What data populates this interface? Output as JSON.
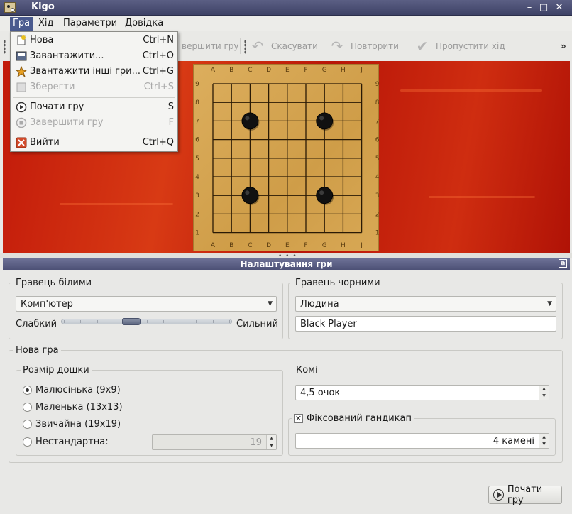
{
  "window": {
    "title": "Kigo"
  },
  "menubar": [
    {
      "label": "Гра"
    },
    {
      "label": "Хід"
    },
    {
      "label": "Параметри"
    },
    {
      "label": "Довідка"
    }
  ],
  "game_menu": {
    "items": [
      {
        "label": "Нова",
        "shortcut": "Ctrl+N",
        "icon": "new-doc-icon",
        "enabled": true
      },
      {
        "label": "Завантажити...",
        "shortcut": "Ctrl+O",
        "icon": "disk-icon",
        "enabled": true
      },
      {
        "label": "Звантажити інші гри...",
        "shortcut": "Ctrl+G",
        "icon": "star-icon",
        "enabled": true
      },
      {
        "label": "Зберегти",
        "shortcut": "Ctrl+S",
        "icon": "save-icon",
        "enabled": false
      },
      {
        "label": "Почати гру",
        "shortcut": "S",
        "icon": "play-icon",
        "enabled": true
      },
      {
        "label": "Завершити гру",
        "shortcut": "F",
        "icon": "stop-icon",
        "enabled": false
      },
      {
        "label": "Вийти",
        "shortcut": "Ctrl+Q",
        "icon": "quit-icon",
        "enabled": true
      }
    ]
  },
  "toolbar": {
    "finish_partial": "вершити гру",
    "undo": "Скасувати",
    "redo": "Повторити",
    "pass": "Пропустити хід",
    "overflow": "»"
  },
  "board": {
    "columns": [
      "A",
      "B",
      "C",
      "D",
      "E",
      "F",
      "G",
      "H",
      "J"
    ],
    "rows": [
      "9",
      "8",
      "7",
      "6",
      "5",
      "4",
      "3",
      "2",
      "1"
    ],
    "stones": [
      {
        "col": "C",
        "row": "7",
        "color": "black"
      },
      {
        "col": "G",
        "row": "7",
        "color": "black"
      },
      {
        "col": "C",
        "row": "3",
        "color": "black"
      },
      {
        "col": "G",
        "row": "3",
        "color": "black"
      }
    ]
  },
  "dock": {
    "title": "Налаштування гри"
  },
  "white_player": {
    "group_label": "Гравець білими",
    "type": "Комп'ютер",
    "weak": "Слабкий",
    "strong": "Сильний",
    "strength": 0.4
  },
  "black_player": {
    "group_label": "Гравець чорними",
    "type": "Людина",
    "name": "Black Player"
  },
  "new_game": {
    "group_label": "Нова гра",
    "board_size": {
      "label": "Розмір дошки",
      "options": [
        "Малюсінька (9x9)",
        "Маленька (13x13)",
        "Звичайна (19x19)",
        "Нестандартна:"
      ],
      "selected": 0,
      "custom_value": "19"
    },
    "komi": {
      "label": "Комі",
      "value": "4,5 очок"
    },
    "handicap": {
      "label": "Фіксований гандикап",
      "checked": true,
      "value": "4 камені"
    }
  },
  "start_button": {
    "label": "Почати гру"
  }
}
